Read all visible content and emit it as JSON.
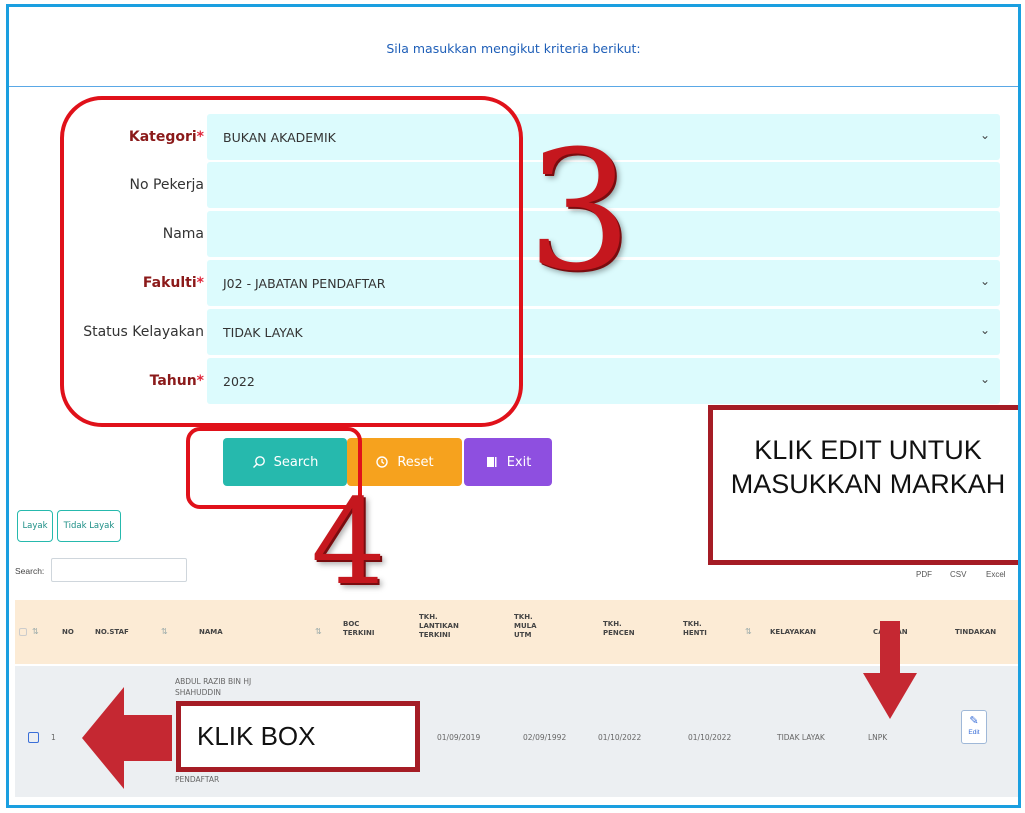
{
  "instruction": "Sila masukkan mengikut kriteria berikut:",
  "form": {
    "kategori": {
      "label": "Kategori",
      "value": "BUKAN AKADEMIK"
    },
    "no_pekerja": {
      "label": "No Pekerja",
      "value": ""
    },
    "nama": {
      "label": "Nama",
      "value": ""
    },
    "fakulti": {
      "label": "Fakulti",
      "value": "J02 - JABATAN PENDAFTAR"
    },
    "status": {
      "label": "Status Kelayakan",
      "value": "TIDAK LAYAK"
    },
    "tahun": {
      "label": "Tahun",
      "value": "2022"
    },
    "required_mark": "*"
  },
  "buttons": {
    "search": "Search",
    "reset": "Reset",
    "exit": "Exit"
  },
  "filters": {
    "layak": "Layak",
    "tidak_layak": "Tidak Layak"
  },
  "table_search_label": "Search:",
  "export": {
    "pdf": "PDF",
    "csv": "CSV",
    "excel": "Excel"
  },
  "table": {
    "headers": {
      "no": "NO",
      "no_staf": "NO.STAF",
      "nama": "NAMA",
      "boc": "BOC TERKINI",
      "lantikan": "TKH. LANTIKAN TERKINI",
      "mula": "TKH. MULA UTM",
      "pencen": "TKH. PENCEN",
      "henti": "TKH. HENTI",
      "kelayakan": "KELAYAKAN",
      "catatan": "CATATAN",
      "tindakan": "TINDAKAN"
    },
    "row": {
      "no": "1",
      "nama_line1": "ABDUL RAZIB BIN HJ",
      "nama_line2": "SHAHUDDIN",
      "nama_line3": "PENDAFTAR",
      "lantikan": "01/09/2019",
      "mula": "02/09/1992",
      "pencen": "01/10/2022",
      "henti": "01/10/2022",
      "kelayakan": "TIDAK LAYAK",
      "catatan": "LNPK",
      "edit_label": "Edit"
    }
  },
  "annotations": {
    "step3": "3",
    "step4": "4",
    "callout_edit": "KLIK EDIT UNTUK MASUKKAN MARKAH",
    "callout_box": "KLIK BOX"
  },
  "colors": {
    "frame": "#1a9fe0",
    "field_bg": "#dcfbfd",
    "search": "#26b9ad",
    "reset": "#f6a21e",
    "exit": "#8e4fe0",
    "annotation_red": "#e0111a",
    "callout_border": "#a51c25"
  }
}
